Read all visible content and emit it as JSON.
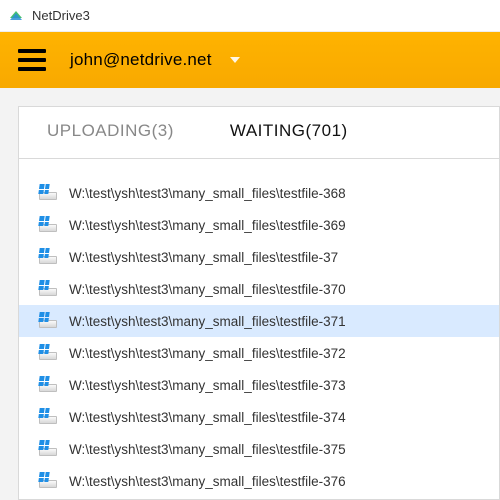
{
  "window": {
    "title": "NetDrive3"
  },
  "header": {
    "user_email": "john@netdrive.net"
  },
  "tabs": {
    "uploading": {
      "label": "UPLOADING",
      "count": 3
    },
    "waiting": {
      "label": "WAITING",
      "count": 701
    },
    "active": "waiting"
  },
  "file_prefix": "W:\\test\\ysh\\test3\\many_small_files\\testfile-",
  "files": [
    {
      "num": "368",
      "selected": false
    },
    {
      "num": "369",
      "selected": false
    },
    {
      "num": "37",
      "selected": false
    },
    {
      "num": "370",
      "selected": false
    },
    {
      "num": "371",
      "selected": true
    },
    {
      "num": "372",
      "selected": false
    },
    {
      "num": "373",
      "selected": false
    },
    {
      "num": "374",
      "selected": false
    },
    {
      "num": "375",
      "selected": false
    },
    {
      "num": "376",
      "selected": false
    }
  ]
}
